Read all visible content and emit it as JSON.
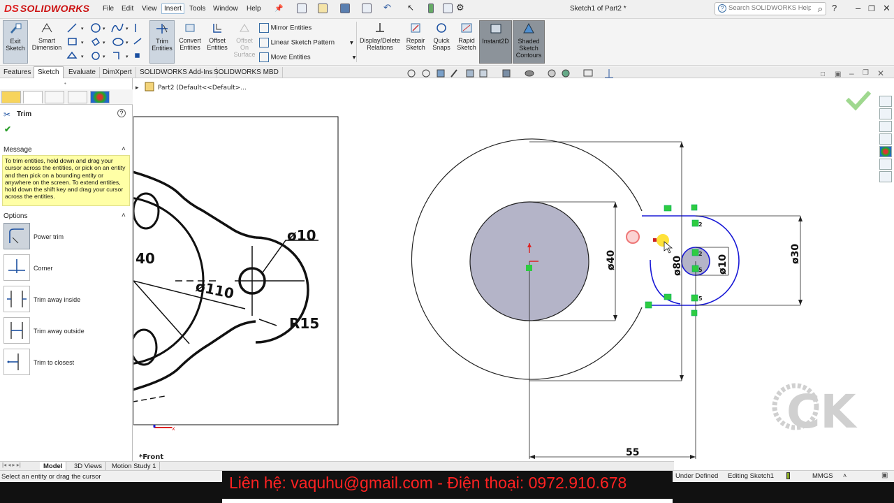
{
  "app": {
    "brand": "SOLIDWORKS",
    "document_title": "Sketch1 of Part2 *",
    "menu": [
      "File",
      "Edit",
      "View",
      "Insert",
      "Tools",
      "Window",
      "Help"
    ],
    "active_menu": "Insert",
    "search_placeholder": "Search SOLIDWORKS Help",
    "help_label": "?"
  },
  "commands": {
    "exit_sketch": "Exit Sketch",
    "smart_dimension": "Smart Dimension",
    "trim_entities": "Trim Entities",
    "convert_entities": "Convert Entities",
    "offset_entities": "Offset Entities",
    "offset_on_surface": "Offset On Surface",
    "mirror_entities": "Mirror Entities",
    "linear_sketch_pattern": "Linear Sketch Pattern",
    "move_entities": "Move Entities",
    "display_delete_relations": "Display/Delete Relations",
    "repair_sketch": "Repair Sketch",
    "quick_snaps": "Quick Snaps",
    "rapid_sketch": "Rapid Sketch",
    "instant2d": "Instant2D",
    "shaded_sketch_contours": "Shaded Sketch Contours"
  },
  "tabs": [
    "Features",
    "Sketch",
    "Evaluate",
    "DimXpert",
    "SOLIDWORKS Add-Ins",
    "SOLIDWORKS MBD"
  ],
  "active_tab": "Sketch",
  "property_manager": {
    "title": "Trim",
    "message_header": "Message",
    "message": "To trim entities, hold down and drag your cursor across the entities, or pick on an entity and then pick on a bounding entity or anywhere on the screen.  To extend entities, hold down the shift key and drag your cursor across the entities.",
    "options_header": "Options",
    "options": [
      {
        "label": "Power trim",
        "selected": true
      },
      {
        "label": "Corner",
        "selected": false
      },
      {
        "label": "Trim away inside",
        "selected": false
      },
      {
        "label": "Trim away outside",
        "selected": false
      },
      {
        "label": "Trim to closest",
        "selected": false
      }
    ]
  },
  "tree": {
    "item": "Part2  (Default<<Default>..."
  },
  "reference_image": {
    "labels": [
      "ø10",
      "ø110",
      "R15",
      "40"
    ]
  },
  "sketch": {
    "dim_outer": "ø80",
    "dim_inner": "ø40",
    "dim_slot": "ø30",
    "dim_hole": "ø10",
    "dim_distance": "55",
    "relation_labels": [
      "2",
      "2",
      "5",
      "5"
    ]
  },
  "view_label": "*Front",
  "watermark": "CK",
  "bottom_tabs": [
    "Model",
    "3D Views",
    "Motion Study 1"
  ],
  "active_bottom_tab": "Model",
  "status": {
    "left": "Select an entity or drag the cursor",
    "contact": "Liên hệ: vaquhu@gmail.com - Điện thoại: 0972.910.678",
    "state": "Under Defined",
    "editing": "Editing Sketch1",
    "units": "MMGS"
  },
  "colors": {
    "sketch_blue": "#1a1ad6",
    "fill_gray": "#b4b4c8",
    "relation_green": "#2ecc40",
    "message_yellow": "#ffffa6",
    "contact_red": "#ff2222"
  }
}
